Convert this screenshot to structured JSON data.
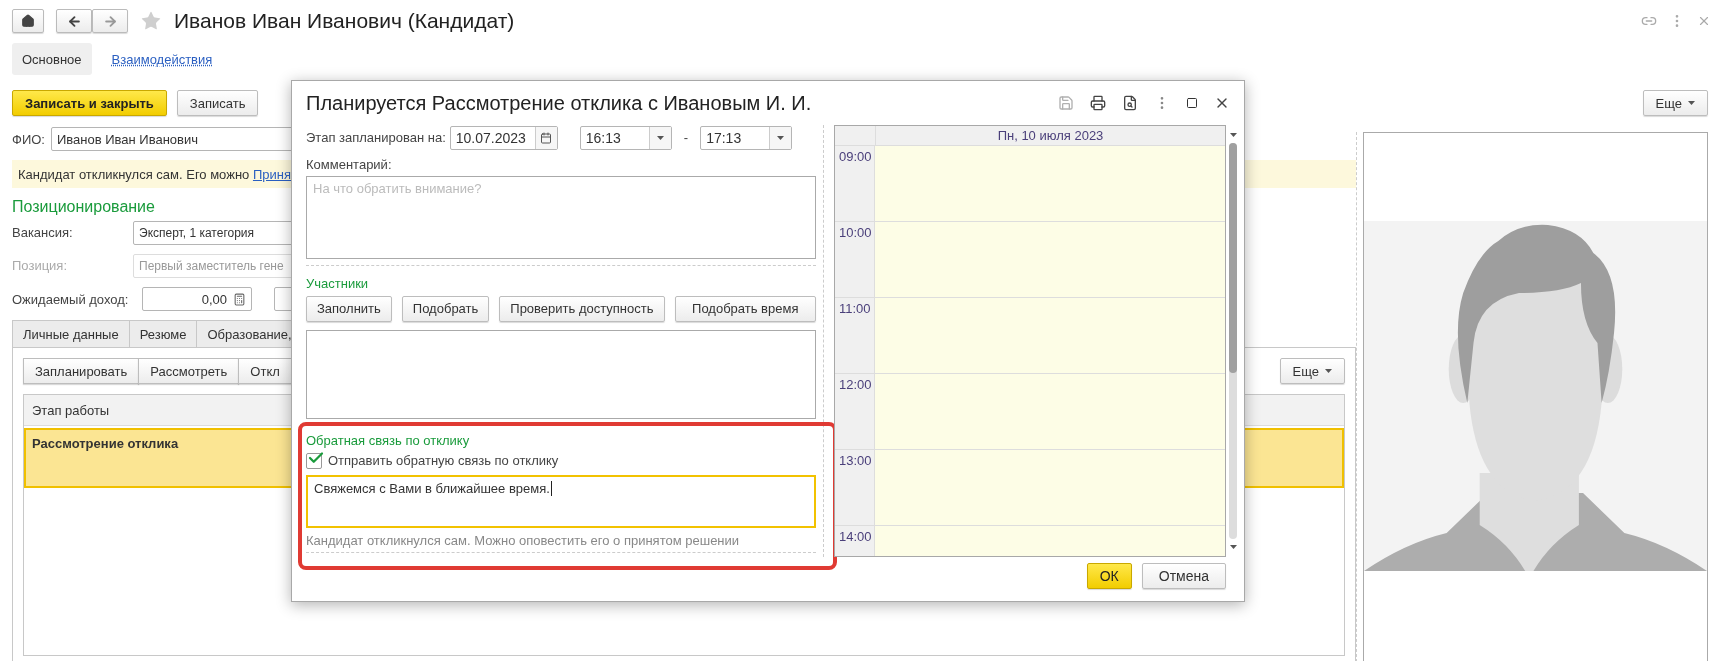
{
  "window": {
    "title": "Иванов Иван Иванович (Кандидат)"
  },
  "nav_tabs": [
    {
      "label": "Основное",
      "selected": true
    },
    {
      "label": "Взаимодействия",
      "selected": false
    }
  ],
  "toolbar": {
    "buttons": [
      {
        "label": "Записать и закрыть",
        "kind": "primary"
      },
      {
        "label": "Записать",
        "kind": "default"
      }
    ],
    "more": "Еще"
  },
  "form": {
    "fio": {
      "label": "ФИО:",
      "value": "Иванов Иван Иванович"
    },
    "notice": {
      "text": "Кандидат откликнулся сам. Его можно",
      "link": "Приня"
    },
    "section_title": "Позиционирование",
    "fields": [
      {
        "label": "Вакансия:",
        "value": "Эксперт, 1 категория",
        "disabled": false
      },
      {
        "label": "Позиция:",
        "value": "Первый заместитель гене",
        "disabled": true
      }
    ],
    "income": {
      "label": "Ожидаемый доход:",
      "value": "0,00"
    }
  },
  "detail_tabs": [
    {
      "label": "Личные данные"
    },
    {
      "label": "Резюме"
    },
    {
      "label": "Образование,"
    }
  ],
  "stage_panel": {
    "buttons": [
      "Запланировать",
      "Рассмотреть",
      "Откл"
    ],
    "more": "Еще",
    "table": {
      "columns": [
        "Этап работы"
      ],
      "rows": [
        {
          "cells": [
            "Рассмотрение отклика"
          ],
          "selected": true
        }
      ]
    }
  },
  "dialog": {
    "title": "Планируется Рассмотрение отклика с Ивановым И. И.",
    "schedule": {
      "label": "Этап запланирован на:",
      "date": "10.07.2023",
      "start": "16:13",
      "separator": "-",
      "end": "17:13"
    },
    "comment": {
      "label": "Комментарий:",
      "placeholder": "На что обратить внимание?"
    },
    "participants": {
      "title": "Участники",
      "buttons": [
        "Заполнить",
        "Подобрать",
        "Проверить доступность",
        "Подобрать время"
      ]
    },
    "feedback": {
      "title": "Обратная связь по отклику",
      "checkbox": {
        "label": "Отправить обратную связь по отклику",
        "checked": true
      },
      "message": "Свяжемся с Вами в ближайшее время.",
      "hint": "Кандидат откликнулся сам. Можно оповестить его о принятом решении"
    },
    "calendar": {
      "day": "Пн, 10 июля 2023",
      "hours": [
        "09:00",
        "10:00",
        "11:00",
        "12:00",
        "13:00",
        "14:00"
      ]
    },
    "buttons": [
      {
        "label": "ОК",
        "kind": "primary"
      },
      {
        "label": "Отмена",
        "kind": "default"
      }
    ]
  }
}
